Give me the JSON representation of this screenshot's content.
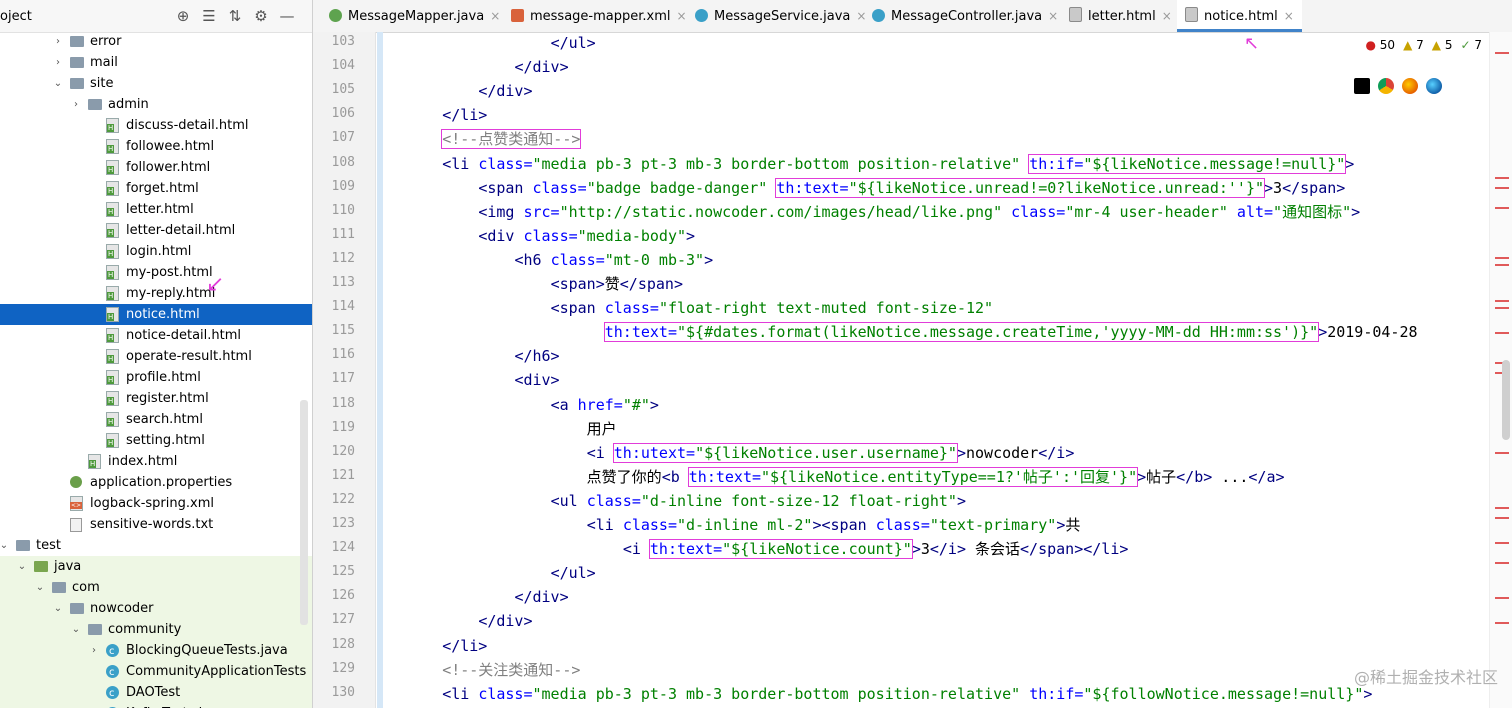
{
  "project_panel": {
    "title": "oject",
    "tools": [
      "⊕",
      "☰",
      "⇅",
      "⚙",
      "—"
    ]
  },
  "tree": [
    {
      "label": "error",
      "depth": 3,
      "icon": "folder",
      "arrow": "›"
    },
    {
      "label": "mail",
      "depth": 3,
      "icon": "folder",
      "arrow": "›"
    },
    {
      "label": "site",
      "depth": 3,
      "icon": "folder",
      "arrow": "⌄"
    },
    {
      "label": "admin",
      "depth": 4,
      "icon": "folder",
      "arrow": "›"
    },
    {
      "label": "discuss-detail.html",
      "depth": 5,
      "icon": "html"
    },
    {
      "label": "followee.html",
      "depth": 5,
      "icon": "html"
    },
    {
      "label": "follower.html",
      "depth": 5,
      "icon": "html"
    },
    {
      "label": "forget.html",
      "depth": 5,
      "icon": "html"
    },
    {
      "label": "letter.html",
      "depth": 5,
      "icon": "html"
    },
    {
      "label": "letter-detail.html",
      "depth": 5,
      "icon": "html"
    },
    {
      "label": "login.html",
      "depth": 5,
      "icon": "html"
    },
    {
      "label": "my-post.html",
      "depth": 5,
      "icon": "html"
    },
    {
      "label": "my-reply.html",
      "depth": 5,
      "icon": "html"
    },
    {
      "label": "notice.html",
      "depth": 5,
      "icon": "html",
      "selected": true
    },
    {
      "label": "notice-detail.html",
      "depth": 5,
      "icon": "html"
    },
    {
      "label": "operate-result.html",
      "depth": 5,
      "icon": "html"
    },
    {
      "label": "profile.html",
      "depth": 5,
      "icon": "html"
    },
    {
      "label": "register.html",
      "depth": 5,
      "icon": "html"
    },
    {
      "label": "search.html",
      "depth": 5,
      "icon": "html"
    },
    {
      "label": "setting.html",
      "depth": 5,
      "icon": "html"
    },
    {
      "label": "index.html",
      "depth": 4,
      "icon": "html"
    },
    {
      "label": "application.properties",
      "depth": 3,
      "icon": "prop"
    },
    {
      "label": "logback-spring.xml",
      "depth": 3,
      "icon": "xml"
    },
    {
      "label": "sensitive-words.txt",
      "depth": 3,
      "icon": "txt"
    },
    {
      "label": "test",
      "depth": 0,
      "icon": "folder",
      "arrow": "⌄"
    },
    {
      "label": "java",
      "depth": 1,
      "icon": "folder-green",
      "arrow": "⌄",
      "test": true
    },
    {
      "label": "com",
      "depth": 2,
      "icon": "folder",
      "arrow": "⌄",
      "test": true
    },
    {
      "label": "nowcoder",
      "depth": 3,
      "icon": "folder",
      "arrow": "⌄",
      "test": true
    },
    {
      "label": "community",
      "depth": 4,
      "icon": "folder",
      "arrow": "⌄",
      "test": true
    },
    {
      "label": "BlockingQueueTests.java",
      "depth": 5,
      "icon": "class",
      "arrow": "›",
      "test": true
    },
    {
      "label": "CommunityApplicationTests",
      "depth": 5,
      "icon": "class",
      "test": true
    },
    {
      "label": "DAOTest",
      "depth": 5,
      "icon": "class",
      "test": true
    },
    {
      "label": "KafkaTests.java",
      "depth": 5,
      "icon": "class",
      "arrow": "›",
      "test": true
    }
  ],
  "tabs": [
    {
      "label": "MessageMapper.java",
      "icon": "green",
      "active": false
    },
    {
      "label": "message-mapper.xml",
      "icon": "xml",
      "active": false
    },
    {
      "label": "MessageService.java",
      "icon": "blue",
      "active": false
    },
    {
      "label": "MessageController.java",
      "icon": "blue",
      "active": false
    },
    {
      "label": "letter.html",
      "icon": "html",
      "active": false
    },
    {
      "label": "notice.html",
      "icon": "html",
      "active": true
    }
  ],
  "tab_close_glyph": "×",
  "inspection": {
    "errors": "50",
    "warnings": "7",
    "weak": "5",
    "ok": "7",
    "error_glyph": "●",
    "warn_glyph": "▲",
    "ok_glyph": "✓"
  },
  "colors": {
    "highlight": "#e13cd9",
    "selection": "#0f63c3",
    "tag": "#000080",
    "attr": "#0000ff",
    "string": "#008000",
    "comment": "#808080"
  },
  "code_lines": [
    {
      "num": "103",
      "tokens": [
        [
          "p",
          "                  "
        ],
        [
          "tag",
          "</ul>"
        ]
      ]
    },
    {
      "num": "104",
      "tokens": [
        [
          "p",
          "              "
        ],
        [
          "tag",
          "</div>"
        ]
      ]
    },
    {
      "num": "105",
      "tokens": [
        [
          "p",
          "          "
        ],
        [
          "tag",
          "</div>"
        ]
      ]
    },
    {
      "num": "106",
      "tokens": [
        [
          "p",
          "      "
        ],
        [
          "tag",
          "</li>"
        ]
      ]
    },
    {
      "num": "107",
      "tokens": [
        [
          "p",
          "      "
        ],
        [
          "comment_hl",
          "<!--点赞类通知-->"
        ]
      ]
    },
    {
      "num": "108",
      "tokens": [
        [
          "p",
          "      "
        ],
        [
          "tag",
          "<li "
        ],
        [
          "attr",
          "class="
        ],
        [
          "str",
          "\"media pb-3 pt-3 mb-3 border-bottom position-relative\""
        ],
        [
          "p",
          " "
        ],
        [
          "hl_attr",
          "th:if=\"${likeNotice.message!=null}\""
        ],
        [
          "tag",
          ">"
        ]
      ]
    },
    {
      "num": "109",
      "tokens": [
        [
          "p",
          "          "
        ],
        [
          "tag",
          "<span "
        ],
        [
          "attr",
          "class="
        ],
        [
          "str",
          "\"badge badge-danger\""
        ],
        [
          "p",
          " "
        ],
        [
          "hl_attr",
          "th:text=\"${likeNotice.unread!=0?likeNotice.unread:''}\""
        ],
        [
          "tag",
          ">"
        ],
        [
          "p",
          "3"
        ],
        [
          "tag",
          "</span>"
        ]
      ]
    },
    {
      "num": "110",
      "tokens": [
        [
          "p",
          "          "
        ],
        [
          "tag",
          "<img "
        ],
        [
          "attr",
          "src="
        ],
        [
          "str",
          "\"http://static.nowcoder.com/images/head/like.png\""
        ],
        [
          "p",
          " "
        ],
        [
          "attr",
          "class="
        ],
        [
          "str",
          "\"mr-4 user-header\""
        ],
        [
          "p",
          " "
        ],
        [
          "attr",
          "alt="
        ],
        [
          "str",
          "\"通知图标\""
        ],
        [
          "tag",
          ">"
        ]
      ]
    },
    {
      "num": "111",
      "tokens": [
        [
          "p",
          "          "
        ],
        [
          "tag",
          "<div "
        ],
        [
          "attr",
          "class="
        ],
        [
          "str",
          "\"media-body\""
        ],
        [
          "tag",
          ">"
        ]
      ]
    },
    {
      "num": "112",
      "tokens": [
        [
          "p",
          "              "
        ],
        [
          "tag",
          "<h6 "
        ],
        [
          "attr",
          "class="
        ],
        [
          "str",
          "\"mt-0 mb-3\""
        ],
        [
          "tag",
          ">"
        ]
      ]
    },
    {
      "num": "113",
      "tokens": [
        [
          "p",
          "                  "
        ],
        [
          "tag",
          "<span>"
        ],
        [
          "p",
          "赞"
        ],
        [
          "tag",
          "</span>"
        ]
      ]
    },
    {
      "num": "114",
      "tokens": [
        [
          "p",
          "                  "
        ],
        [
          "tag",
          "<span "
        ],
        [
          "attr",
          "class="
        ],
        [
          "str",
          "\"float-right text-muted font-size-12\""
        ]
      ]
    },
    {
      "num": "115",
      "tokens": [
        [
          "p",
          "                        "
        ],
        [
          "hl_attr",
          "th:text=\"${#dates.format(likeNotice.message.createTime,'yyyy-MM-dd HH:mm:ss')}\""
        ],
        [
          "tag",
          ">"
        ],
        [
          "p",
          "2019-04-28"
        ]
      ]
    },
    {
      "num": "116",
      "tokens": [
        [
          "p",
          "              "
        ],
        [
          "tag",
          "</h6>"
        ]
      ]
    },
    {
      "num": "117",
      "tokens": [
        [
          "p",
          "              "
        ],
        [
          "tag",
          "<div>"
        ]
      ]
    },
    {
      "num": "118",
      "tokens": [
        [
          "p",
          "                  "
        ],
        [
          "tag",
          "<a "
        ],
        [
          "attr",
          "href="
        ],
        [
          "str",
          "\"#\""
        ],
        [
          "tag",
          ">"
        ]
      ]
    },
    {
      "num": "119",
      "tokens": [
        [
          "p",
          "                      用户"
        ]
      ]
    },
    {
      "num": "120",
      "tokens": [
        [
          "p",
          "                      "
        ],
        [
          "tag",
          "<i "
        ],
        [
          "hl_attr",
          "th:utext=\"${likeNotice.user.username}\""
        ],
        [
          "tag",
          ">"
        ],
        [
          "p",
          "nowcoder"
        ],
        [
          "tag",
          "</i>"
        ]
      ]
    },
    {
      "num": "121",
      "tokens": [
        [
          "p",
          "                      点赞了你的"
        ],
        [
          "tag",
          "<b "
        ],
        [
          "hl_attr",
          "th:text=\"${likeNotice.entityType==1?'帖子':'回复'}\""
        ],
        [
          "tag",
          ">"
        ],
        [
          "p",
          "帖子"
        ],
        [
          "tag",
          "</b>"
        ],
        [
          "p",
          " ..."
        ],
        [
          "tag",
          "</a>"
        ]
      ]
    },
    {
      "num": "122",
      "tokens": [
        [
          "p",
          "                  "
        ],
        [
          "tag",
          "<ul "
        ],
        [
          "attr",
          "class="
        ],
        [
          "str",
          "\"d-inline font-size-12 float-right\""
        ],
        [
          "tag",
          ">"
        ]
      ]
    },
    {
      "num": "123",
      "tokens": [
        [
          "p",
          "                      "
        ],
        [
          "tag",
          "<li "
        ],
        [
          "attr",
          "class="
        ],
        [
          "str",
          "\"d-inline ml-2\""
        ],
        [
          "tag",
          "><span "
        ],
        [
          "attr",
          "class="
        ],
        [
          "str",
          "\"text-primary\""
        ],
        [
          "tag",
          ">"
        ],
        [
          "p",
          "共"
        ]
      ]
    },
    {
      "num": "124",
      "tokens": [
        [
          "p",
          "                          "
        ],
        [
          "tag",
          "<i "
        ],
        [
          "hl_attr",
          "th:text=\"${likeNotice.count}\""
        ],
        [
          "tag",
          ">"
        ],
        [
          "p",
          "3"
        ],
        [
          "tag",
          "</i>"
        ],
        [
          "p",
          " 条会话"
        ],
        [
          "tag",
          "</span></li>"
        ]
      ]
    },
    {
      "num": "125",
      "tokens": [
        [
          "p",
          "                  "
        ],
        [
          "tag",
          "</ul>"
        ]
      ]
    },
    {
      "num": "126",
      "tokens": [
        [
          "p",
          "              "
        ],
        [
          "tag",
          "</div>"
        ]
      ]
    },
    {
      "num": "127",
      "tokens": [
        [
          "p",
          "          "
        ],
        [
          "tag",
          "</div>"
        ]
      ]
    },
    {
      "num": "128",
      "tokens": [
        [
          "p",
          "      "
        ],
        [
          "tag",
          "</li>"
        ]
      ]
    },
    {
      "num": "129",
      "tokens": [
        [
          "p",
          "      "
        ],
        [
          "comment",
          "<!--关注类通知-->"
        ]
      ]
    },
    {
      "num": "130",
      "tokens": [
        [
          "p",
          "      "
        ],
        [
          "tag",
          "<li "
        ],
        [
          "attr",
          "class="
        ],
        [
          "str",
          "\"media pb-3 pt-3 mb-3 border-bottom position-relative\""
        ],
        [
          "p",
          " "
        ],
        [
          "attr",
          "th:if="
        ],
        [
          "str",
          "\"${followNotice.message!=null}\""
        ],
        [
          "tag",
          ">"
        ]
      ]
    }
  ],
  "watermark": "@稀土掘金技术社区"
}
